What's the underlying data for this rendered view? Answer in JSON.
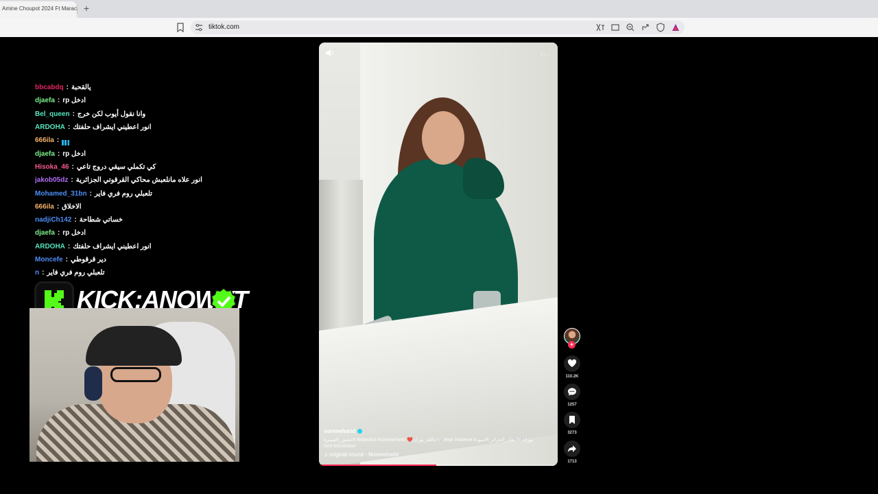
{
  "browser": {
    "tab_title": "Amine Choupot 2024 Ft Marac",
    "url": "tiktok.com"
  },
  "chat": [
    {
      "user": "bbcabdq",
      "color": "#e0245e",
      "text": "يالقحبة"
    },
    {
      "user": "djaefa",
      "color": "#7ef08c",
      "text": "ادخل rp"
    },
    {
      "user": "Bel_queen",
      "color": "#55e6c1",
      "text": "وانا نقول أيوب لكن خرج"
    },
    {
      "user": "ARDOHA",
      "color": "#55e6c1",
      "text": "انور اعطيني ايشراف حلفتك"
    },
    {
      "user": "666ila",
      "color": "#f4b36b",
      "text": "",
      "emote": true
    },
    {
      "user": "djaefa",
      "color": "#7ef08c",
      "text": "ادخل rp"
    },
    {
      "user": "Hisoka_46",
      "color": "#f45b8a",
      "text": "كي تكملي سيقي دروج تاعي"
    },
    {
      "user": "jakob05dz",
      "color": "#b06cf5",
      "text": "انور علاه مانلعبش محاكي القرقوتي الجزائرية"
    },
    {
      "user": "Mohamed_31bn",
      "color": "#4e8ef5",
      "text": "تلعبلي روم فري فاير"
    },
    {
      "user": "666ila",
      "color": "#f4b36b",
      "text": "الاخلاق"
    },
    {
      "user": "nadjiCh142",
      "color": "#4e8ef5",
      "text": "خساتي شطاحة"
    },
    {
      "user": "djaefa",
      "color": "#7ef08c",
      "text": "ادخل rp"
    },
    {
      "user": "ARDOHA",
      "color": "#55e6c1",
      "text": "انور اعطيني ايشراف حلفتك"
    },
    {
      "user": "Moncefe",
      "color": "#4e8ef5",
      "text": "دير قرقوطي"
    },
    {
      "user": "n",
      "color": "#4e8ef5",
      "text": "تلعبلي روم فري فاير"
    }
  ],
  "overlay": {
    "kick_text": "KICK:ANOWYT"
  },
  "video": {
    "author": "noreneharid",
    "hashtags": "عشق_السمرة# #istanbul #noreneharid ❤️عائلة_نوران🤍 #nor #norene #نوران🤍 ضل_الحزام_الاسود",
    "see_translation": "See translation",
    "sound": "original sound - Noreneharid",
    "progress": 0.49,
    "more": "···"
  },
  "actions": {
    "likes": "110.2K",
    "comments": "1257",
    "saves": "3273",
    "shares": "1713"
  },
  "colors": {
    "accent": "#fe2c55",
    "kick_green": "#53fc18"
  }
}
